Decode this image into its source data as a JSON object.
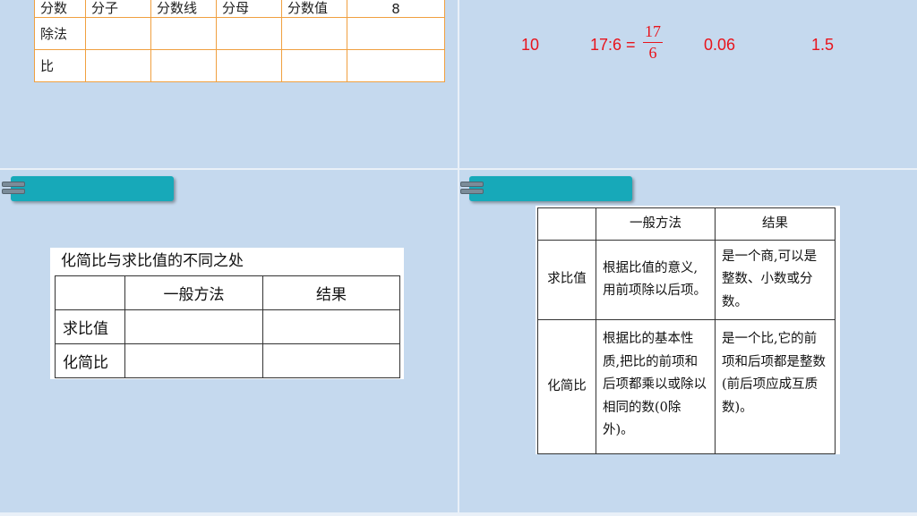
{
  "top_left_table": {
    "header_row": [
      "分数",
      "分子",
      "分数线",
      "分母",
      "分数值",
      "8"
    ],
    "rows": [
      {
        "label": "除法"
      },
      {
        "label": "比"
      }
    ]
  },
  "answers": {
    "a1": "10",
    "a2_prefix": "17:6 =",
    "a2_numerator": "17",
    "a2_denominator": "6",
    "a3": "0.06",
    "a4": "1.5"
  },
  "practice_card": {
    "caption": "化简比与求比值的不同之处",
    "headers": [
      "",
      "一般方法",
      "结果"
    ],
    "rows": [
      "求比值",
      "化简比"
    ]
  },
  "answer_card": {
    "headers": [
      "",
      "一般方法",
      "结果"
    ],
    "rows": [
      {
        "label": "求比值",
        "method": "根据比值的意义,用前项除以后项。",
        "result": "是一个商,可以是整数、小数或分数。"
      },
      {
        "label": "化简比",
        "method": "根据比的基本性质,把比的前项和后项都乘以或除以相同的数(0除外)。",
        "result": "是一个比,它的前项和后项都是整数(前后项应成互质数)。"
      }
    ]
  },
  "colors": {
    "background": "#c5d9ee",
    "accent_tab": "#17a9b9",
    "answer_red": "#e8141c",
    "grid_orange": "#f0a040"
  }
}
